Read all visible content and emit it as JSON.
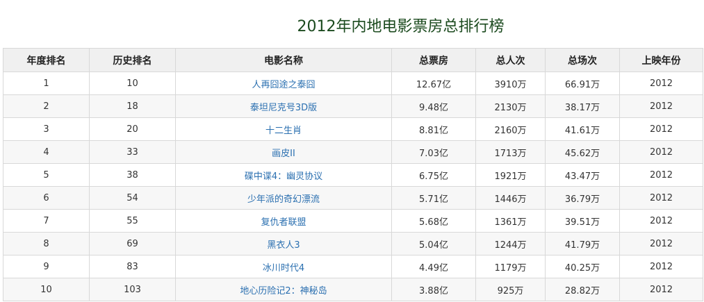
{
  "title": "2012年内地电影票房总排行榜",
  "headers": [
    "年度排名",
    "历史排名",
    "电影名称",
    "总票房",
    "总人次",
    "总场次",
    "上映年份"
  ],
  "rows": [
    {
      "year_rank": "1",
      "hist_rank": "10",
      "name": "人再囧途之泰囧",
      "gross": "12.67亿",
      "admissions": "3910万",
      "screenings": "66.91万",
      "year": "2012"
    },
    {
      "year_rank": "2",
      "hist_rank": "18",
      "name": "泰坦尼克号3D版",
      "gross": "9.48亿",
      "admissions": "2130万",
      "screenings": "38.17万",
      "year": "2012"
    },
    {
      "year_rank": "3",
      "hist_rank": "20",
      "name": "十二生肖",
      "gross": "8.81亿",
      "admissions": "2160万",
      "screenings": "41.61万",
      "year": "2012"
    },
    {
      "year_rank": "4",
      "hist_rank": "33",
      "name": "画皮II",
      "gross": "7.03亿",
      "admissions": "1713万",
      "screenings": "45.62万",
      "year": "2012"
    },
    {
      "year_rank": "5",
      "hist_rank": "38",
      "name": "碟中谍4：幽灵协议",
      "gross": "6.75亿",
      "admissions": "1921万",
      "screenings": "43.47万",
      "year": "2012"
    },
    {
      "year_rank": "6",
      "hist_rank": "54",
      "name": "少年派的奇幻漂流",
      "gross": "5.71亿",
      "admissions": "1446万",
      "screenings": "36.79万",
      "year": "2012"
    },
    {
      "year_rank": "7",
      "hist_rank": "55",
      "name": "复仇者联盟",
      "gross": "5.68亿",
      "admissions": "1361万",
      "screenings": "39.51万",
      "year": "2012"
    },
    {
      "year_rank": "8",
      "hist_rank": "69",
      "name": "黑衣人3",
      "gross": "5.04亿",
      "admissions": "1244万",
      "screenings": "41.79万",
      "year": "2012"
    },
    {
      "year_rank": "9",
      "hist_rank": "83",
      "name": "冰川时代4",
      "gross": "4.49亿",
      "admissions": "1179万",
      "screenings": "40.25万",
      "year": "2012"
    },
    {
      "year_rank": "10",
      "hist_rank": "103",
      "name": "地心历险记2：神秘岛",
      "gross": "3.88亿",
      "admissions": "925万",
      "screenings": "28.82万",
      "year": "2012"
    }
  ],
  "colors": {
    "title": "#1b4a1e",
    "link": "#2a6fb0",
    "header_bg": "#f0f0f0",
    "border": "#d8d8d8"
  }
}
